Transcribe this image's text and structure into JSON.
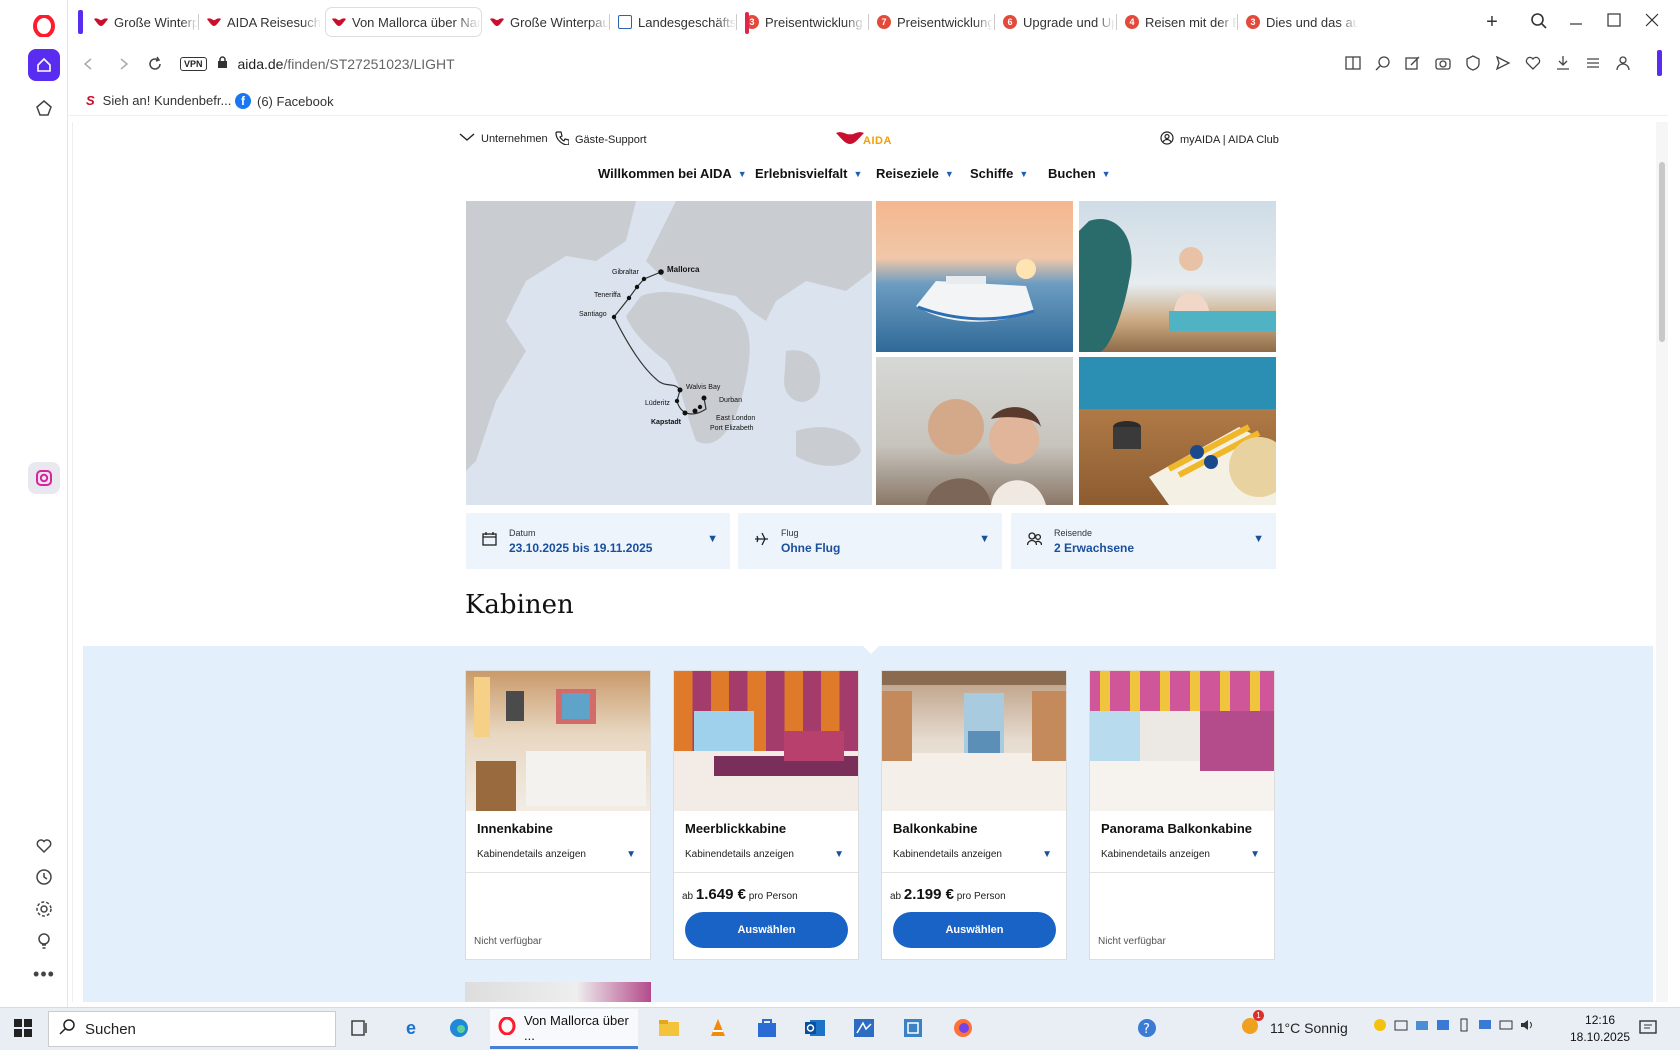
{
  "browser": {
    "tabs": [
      {
        "title": "Große Winterpause",
        "fav": "aida-icon",
        "color": "#c8102e"
      },
      {
        "title": "AIDA Reisesuche –",
        "fav": "aida-icon",
        "color": "#c8102e"
      },
      {
        "title": "Von Mallorca über Namib",
        "fav": "aida-icon",
        "color": "#c8102e",
        "active": true
      },
      {
        "title": "Große Winterpause",
        "fav": "aida-icon",
        "color": "#c8102e"
      },
      {
        "title": "Landesgeschäftsste",
        "fav": "agency-icon",
        "color": "#2a62b5"
      },
      {
        "title": "Preisentwicklung A",
        "fav": "badge-icon",
        "color": "#e24a3b",
        "badge": "3"
      },
      {
        "title": "Preisentwicklung A",
        "fav": "badge-icon",
        "color": "#e24a3b",
        "badge": "7"
      },
      {
        "title": "Upgrade und Upse",
        "fav": "badge-icon",
        "color": "#e24a3b",
        "badge": "6"
      },
      {
        "title": "Reisen mit der Bah",
        "fav": "badge-icon",
        "color": "#e24a3b",
        "badge": "4"
      },
      {
        "title": "Dies und das aus d",
        "fav": "badge-icon",
        "color": "#e24a3b",
        "badge": "3"
      }
    ],
    "new_tab": "+",
    "address": {
      "host": "aida.de",
      "path": "/finden/ST27251023/LIGHT",
      "vpn": "VPN"
    },
    "bookmarks": [
      {
        "label": "Sieh an! Kundenbefr...",
        "icon": "s-logo-icon"
      },
      {
        "label": "(6) Facebook",
        "icon": "facebook-icon"
      }
    ]
  },
  "site": {
    "top_links": {
      "company": "Unternehmen",
      "support": "Gäste-Support",
      "logo": "AIDA",
      "account": "myAIDA | AIDA Club"
    },
    "menu": [
      "Willkommen bei AIDA",
      "Erlebnisvielfalt",
      "Reiseziele",
      "Schiffe",
      "Buchen"
    ],
    "map_ports": [
      "Mallorca",
      "Gibraltar",
      "Teneriffa",
      "Santiago",
      "Walvis Bay",
      "Lüderitz",
      "Durban",
      "Kapstadt",
      "East London",
      "Port Elizabeth"
    ],
    "filters": [
      {
        "label": "Datum",
        "value": "23.10.2025 bis 19.11.2025",
        "icon": "calendar-icon"
      },
      {
        "label": "Flug",
        "value": "Ohne Flug",
        "icon": "plane-icon"
      },
      {
        "label": "Reisende",
        "value": "2 Erwachsene",
        "icon": "people-icon"
      }
    ],
    "section_title": "Kabinen",
    "cabins": [
      {
        "name": "Innenkabine",
        "details": "Kabinendetails anzeigen",
        "available": false,
        "na_text": "Nicht verfügbar"
      },
      {
        "name": "Meerblickkabine",
        "details": "Kabinendetails anzeigen",
        "available": true,
        "price_prefix": "ab",
        "price": "1.649 €",
        "price_suffix": "pro Person",
        "button": "Auswählen"
      },
      {
        "name": "Balkonkabine",
        "details": "Kabinendetails anzeigen",
        "available": true,
        "price_prefix": "ab",
        "price": "2.199 €",
        "price_suffix": "pro Person",
        "button": "Auswählen"
      },
      {
        "name": "Panorama Balkonkabine",
        "details": "Kabinendetails anzeigen",
        "available": false,
        "na_text": "Nicht verfügbar"
      }
    ]
  },
  "taskbar": {
    "search_placeholder": "Suchen",
    "active_app": "Von Mallorca über ...",
    "weather": "11°C  Sonnig",
    "time": "12:16",
    "date": "18.10.2025",
    "weather_badge": "1"
  }
}
